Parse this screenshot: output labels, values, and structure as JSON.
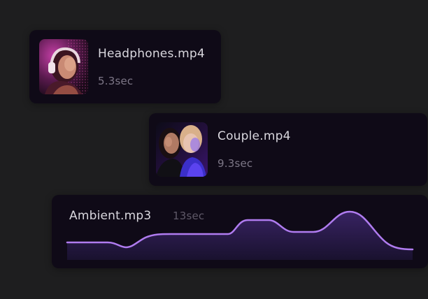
{
  "files": [
    {
      "name": "Headphones.mp4",
      "duration": "5.3sec",
      "thumbnail": "portrait-with-headphones"
    },
    {
      "name": "Couple.mp4",
      "duration": "9.3sec",
      "thumbnail": "two-people-portrait"
    },
    {
      "name": "Ambient.mp3",
      "duration": "13sec",
      "waveform": "audio-waveform"
    }
  ],
  "colors": {
    "background": "#1e1e1f",
    "card": "#0f0a17",
    "accent": "#b07cf0",
    "title_text": "#d9d7de",
    "meta_text": "#7d7787"
  }
}
